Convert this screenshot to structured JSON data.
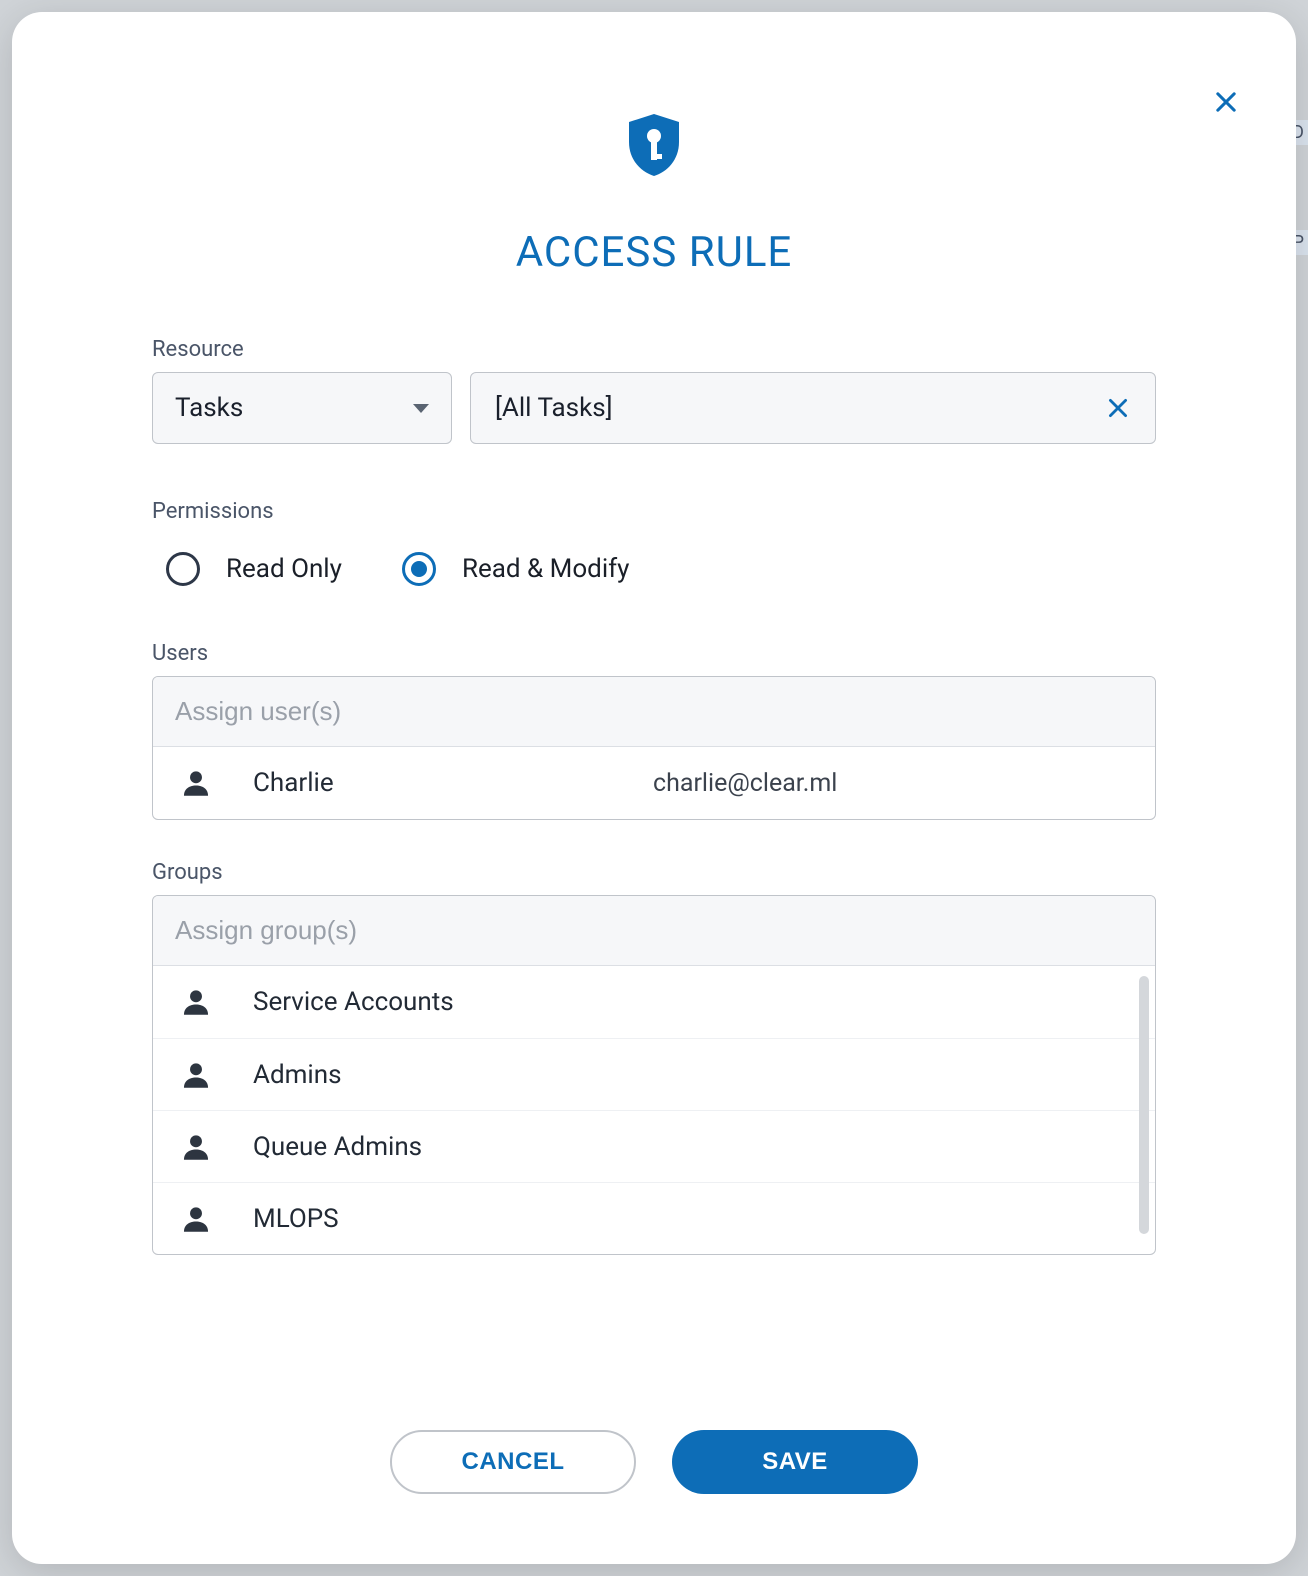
{
  "behind": {
    "hint1": "AD",
    "hint2": "IP"
  },
  "modal": {
    "title": "ACCESS RULE",
    "close_label": "Close"
  },
  "resource": {
    "label": "Resource",
    "selected_type": "Tasks",
    "selected_value": "[All Tasks]"
  },
  "permissions": {
    "label": "Permissions",
    "options": [
      {
        "label": "Read Only",
        "selected": false
      },
      {
        "label": "Read & Modify",
        "selected": true
      }
    ]
  },
  "users": {
    "label": "Users",
    "placeholder": "Assign user(s)",
    "items": [
      {
        "name": "Charlie",
        "email": "charlie@clear.ml"
      }
    ]
  },
  "groups": {
    "label": "Groups",
    "placeholder": "Assign group(s)",
    "items": [
      {
        "name": "Service Accounts"
      },
      {
        "name": "Admins"
      },
      {
        "name": "Queue Admins"
      },
      {
        "name": "MLOPS"
      }
    ]
  },
  "actions": {
    "cancel": "CANCEL",
    "save": "SAVE"
  },
  "colors": {
    "primary": "#0d6db7"
  }
}
